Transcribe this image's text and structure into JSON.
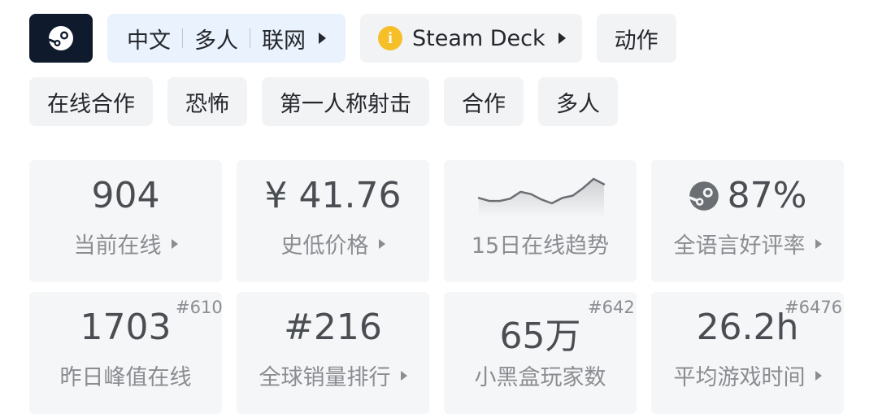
{
  "tags_row1": {
    "languages": [
      "中文",
      "多人",
      "联网"
    ],
    "steam_deck_label": "Steam Deck",
    "genre": "动作"
  },
  "tags_row2": [
    "在线合作",
    "恐怖",
    "第一人称射击",
    "合作",
    "多人"
  ],
  "stats": {
    "current_online": {
      "value": "904",
      "label": "当前在线"
    },
    "lowest_price": {
      "value": "¥ 41.76",
      "label": "史低价格"
    },
    "trend": {
      "label": "15日在线趋势",
      "points": [
        22,
        18,
        18,
        21,
        30,
        27,
        20,
        15,
        22,
        25,
        35,
        47,
        40
      ]
    },
    "rating": {
      "value": "87%",
      "label": "全语言好评率"
    },
    "peak_yesterday": {
      "value": "1703",
      "rank": "#610",
      "label": "昨日峰值在线"
    },
    "global_sales": {
      "value": "#216",
      "label": "全球销量排行"
    },
    "heybox_players": {
      "value": "65万",
      "rank": "#642",
      "label": "小黑盒玩家数"
    },
    "avg_playtime": {
      "value": "26.2h",
      "rank": "#6476",
      "label": "平均游戏时间"
    }
  },
  "colors": {
    "steam_button_bg": "#0f1b2d",
    "language_tag_bg": "#e9f2fd",
    "warning_icon": "#f6bf2a",
    "card_bg": "#f5f6f7",
    "sparkline": "#6b6e73"
  }
}
